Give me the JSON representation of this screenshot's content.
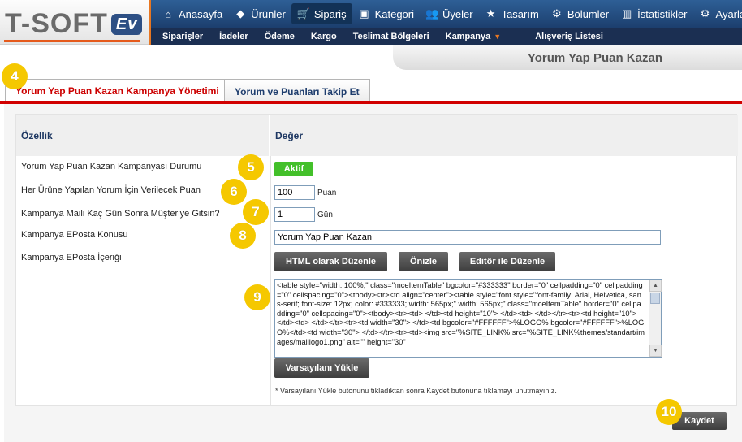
{
  "logo": {
    "text": "T-SOFT",
    "ev": "Ev"
  },
  "nav": {
    "items": [
      {
        "label": "Anasayfa",
        "icon": "⌂"
      },
      {
        "label": "Ürünler",
        "icon": "◆"
      },
      {
        "label": "Sipariş",
        "icon": "🛒"
      },
      {
        "label": "Kategori",
        "icon": "▣"
      },
      {
        "label": "Üyeler",
        "icon": "👥"
      },
      {
        "label": "Tasarım",
        "icon": "★"
      },
      {
        "label": "Bölümler",
        "icon": "⚙"
      },
      {
        "label": "İstatistikler",
        "icon": "▥"
      },
      {
        "label": "Ayarlar",
        "icon": "⚙"
      }
    ],
    "sub_items": [
      "Siparişler",
      "İadeler",
      "Ödeme",
      "Kargo",
      "Teslimat Bölgeleri",
      "Kampanya",
      "Alışveriş Listesi"
    ]
  },
  "page_title": "Yorum Yap Puan Kazan",
  "tabs": [
    {
      "label": "Yorum Yap Puan Kazan Kampanya Yönetimi"
    },
    {
      "label": "Yorum ve Puanları Takip Et"
    }
  ],
  "table": {
    "header_left": "Özellik",
    "header_right": "Değer"
  },
  "rows": {
    "status_label": "Yorum Yap Puan Kazan Kampanyası Durumu",
    "status_value": "Aktif",
    "points_label": "Her Ürüne Yapılan Yorum İçin Verilecek Puan",
    "points_value": "100",
    "points_unit": "Puan",
    "days_label": "Kampanya Maili Kaç Gün Sonra Müşteriye Gitsin?",
    "days_value": "1",
    "days_unit": "Gün",
    "subject_label": "Kampanya EPosta Konusu",
    "subject_value": "Yorum Yap Puan Kazan",
    "content_label": "Kampanya EPosta İçeriği"
  },
  "buttons": {
    "html_edit": "HTML olarak Düzenle",
    "preview": "Önizle",
    "editor_edit": "Editör ile Düzenle",
    "load_default": "Varsayılanı Yükle",
    "save": "Kaydet"
  },
  "email_content": "<table style=\"width: 100%;\" class=\"mceItemTable\" bgcolor=\"#333333\" border=\"0\" cellpadding=\"0\" cellpadding=\"0\" cellspacing=\"0\"><tbody><tr><td align=\"center\"><table style=\"font style=\"font-family: Arial, Helvetica, sans-serif; font-size: 12px; color: #333333; width: 565px;\" width: 565px;\" class=\"mceItemTable\" border=\"0\" cellpadding=\"0\" cellspacing=\"0\"><tbody><tr><td> </td><td height=\"10\"> </td><td> </td></tr><tr><td height=\"10\"> </td><td> </td></tr><tr><td width=\"30\"> </td><td bgcolor=\"#FFFFFF\">%LOGO% bgcolor=\"#FFFFFF\">%LOGO%</td><td width=\"30\"> </td></tr><tr><td><img src=\"%SITE_LINK% src=\"%SITE_LINK%themes/standart/images/maillogo1.png\" alt=\"\" height=\"30\"",
  "note": "* Varsayılanı Yükle butonunu tıkladıktan sonra Kaydet butonuna tıklamayı unutmayınız.",
  "badges": [
    "4",
    "5",
    "6",
    "7",
    "8",
    "9",
    "10"
  ]
}
